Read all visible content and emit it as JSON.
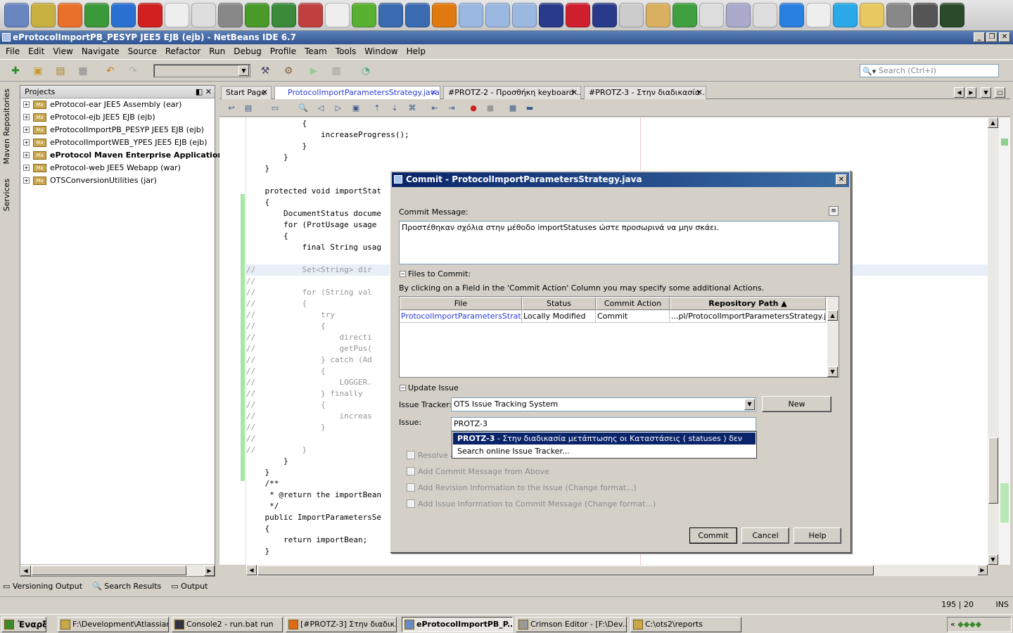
{
  "launchbar": {
    "icons": [
      "computer-icon",
      "display-icon",
      "firefox-icon",
      "chrome-icon",
      "ie-icon",
      "opera-icon",
      "dog-icon",
      "tools-icon",
      "hammer-icon",
      "frog-icon",
      "green-b-icon",
      "paint-icon",
      "x-window-icon",
      "green-leaf-icon",
      "globe-icon",
      "notes-icon",
      "shield-icon",
      "cube-icon",
      "cube-icon",
      "cube-icon",
      "ball-icon",
      "stop-icon",
      "calculator-icon",
      "gear-icon",
      "cat-icon",
      "plus-icon",
      "window-icon",
      "sync-icon",
      "edit-icon",
      "dot-icon",
      "doc-icon",
      "skype-icon",
      "folder-icon",
      "gimp-icon",
      "spider-icon",
      "terminal-icon"
    ]
  },
  "window": {
    "title": "eProtocolImportPB_PESYP JEE5 EJB (ejb) - NetBeans IDE 6.7"
  },
  "menu": [
    "File",
    "Edit",
    "View",
    "Navigate",
    "Source",
    "Refactor",
    "Run",
    "Debug",
    "Profile",
    "Team",
    "Tools",
    "Window",
    "Help"
  ],
  "search": {
    "placeholder": "Search (Ctrl+I)"
  },
  "sidebar": {
    "maven": "Maven Repositories",
    "services": "Services"
  },
  "projects": {
    "title": "Projects",
    "items": [
      {
        "label": "eProtocol-ear JEE5 Assembly (ear)",
        "bold": false
      },
      {
        "label": "eProtocol-ejb JEE5 EJB (ejb)",
        "bold": false
      },
      {
        "label": "eProtocolImportPB_PESYP JEE5 EJB (ejb)",
        "bold": false
      },
      {
        "label": "eProtocolImportWEB_YPES JEE5 EJB (ejb)",
        "bold": false
      },
      {
        "label": "eProtocol Maven Enterprise Application (p",
        "bold": true
      },
      {
        "label": "eProtocol-web JEE5 Webapp (war)",
        "bold": false
      },
      {
        "label": "OTSConversionUtilities (jar)",
        "bold": false
      }
    ]
  },
  "bottom_tabs": [
    "Versioning Output",
    "Search Results",
    "Output"
  ],
  "editor_tabs": [
    {
      "label": "Start Page",
      "active": false
    },
    {
      "label": "ProtocolImportParametersStrategy.java",
      "active": true
    },
    {
      "label": "#PROTZ-2 - Προσθήκη keyboard ...",
      "active": false
    },
    {
      "label": "#PROTZ-3 - Στην διαδικασία ...",
      "active": false
    }
  ],
  "code": [
    "            {",
    "                increaseProgress();",
    "            }",
    "        }",
    "    }",
    "",
    "    protected void importStat",
    "    {",
    "        DocumentStatus docume",
    "        for (ProtUsage usage",
    "        {",
    "            final String usag",
    "",
    "//          Set<String> dir",
    "//",
    "//          for (String val",
    "//          {",
    "//              try",
    "//              {",
    "//                  directi",
    "//                  getPus(",
    "//              } catch (Ad",
    "//              {",
    "//                  LOGGER.",
    "//              } finally",
    "//              {",
    "//                  increas",
    "//              }",
    "//",
    "//          }",
    "        }",
    "    }",
    "    /**",
    "     * @return the importBean",
    "     */",
    "    public ImportParametersSe",
    "    {",
    "        return importBean;",
    "    }"
  ],
  "status": {
    "position": "195 | 20",
    "mode": "INS"
  },
  "taskbar": {
    "start": "Έναρξη",
    "items": [
      {
        "label": "F:\\Development\\Atlassian",
        "active": false
      },
      {
        "label": "Console2 - run.bat run",
        "active": false
      },
      {
        "label": "[#PROTZ-3] Στην διαδικ...",
        "active": false
      },
      {
        "label": "eProtocolImportPB_P...",
        "active": true
      },
      {
        "label": "Crimson Editor - [F:\\Dev...",
        "active": false
      },
      {
        "label": "C:\\ots2\\reports",
        "active": false
      }
    ],
    "tray": "«"
  },
  "dialog": {
    "title": "Commit - ProtocolImportParametersStrategy.java",
    "commit_message_label": "Commit Message:",
    "commit_message": "Προστέθηκαν σχόλια στην μέθοδο importStatuses ώστε προσωρινά να μην σκάει.",
    "files_label": "Files to Commit:",
    "files_hint": "By clicking on a Field in the 'Commit Action' Column you may specify some additional Actions.",
    "columns": [
      "File",
      "Status",
      "Commit Action",
      "Repository Path ▲"
    ],
    "rows": [
      {
        "file": "ProtocolImportParametersStrategy.",
        "status": "Locally Modified",
        "action": "Commit",
        "path": "...pl/ProtocolImportParametersStrategy.java"
      }
    ],
    "update_issue_label": "Update Issue",
    "issue_tracker_label": "Issue Tracker:",
    "issue_tracker_value": "OTS Issue Tracking System",
    "new_button": "New",
    "issue_label": "Issue:",
    "issue_value": "PROTZ-3",
    "suggestion_selected_key": "PROTZ-3",
    "suggestion_selected_text": " - Στην διαδικασία μετάπτωσης οι Καταστάσεις ( statuses ) δεν",
    "suggestion_search": "Search online Issue Tracker...",
    "checkboxes": [
      "Resolve a",
      "Add Commit Message from Above",
      "Add Revision Information to the Issue   (Change format...)",
      "Add Issue Information to Commit Message   (Change format...)"
    ],
    "buttons": {
      "commit": "Commit",
      "cancel": "Cancel",
      "help": "Help"
    }
  }
}
